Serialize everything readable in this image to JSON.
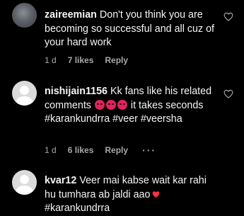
{
  "comments": [
    {
      "username": "zaireemian",
      "text": "Don't you think you are becoming so successful and all cuz of your hard work",
      "time": "1 d",
      "likes": "7 likes",
      "reply": "Reply",
      "avatar": "profile-photo"
    },
    {
      "username": "nishijain1156",
      "text_before": "Kk fans like his related comments",
      "emoji_count": 3,
      "text_after": "it takes seconds #karankundrra #veer #veersha",
      "time": "1 d",
      "likes": "6 likes",
      "reply": "Reply",
      "more": "···",
      "avatar": "default-user-icon"
    },
    {
      "username": "kvar12",
      "text_before": "Veer mai kabse wait kar rahi hu tumhara ab jaldi aao",
      "text_after": "#karankundrra",
      "avatar": "default-user-icon"
    }
  ],
  "colors": {
    "background": "#000000",
    "text": "#f5f5f5",
    "meta": "#a8a8a8",
    "heart": "#ff3040"
  },
  "icons": [
    "heart-outline-icon",
    "heart-emoji-icon",
    "pouting-face-emoji-icon",
    "more-dots-icon"
  ]
}
